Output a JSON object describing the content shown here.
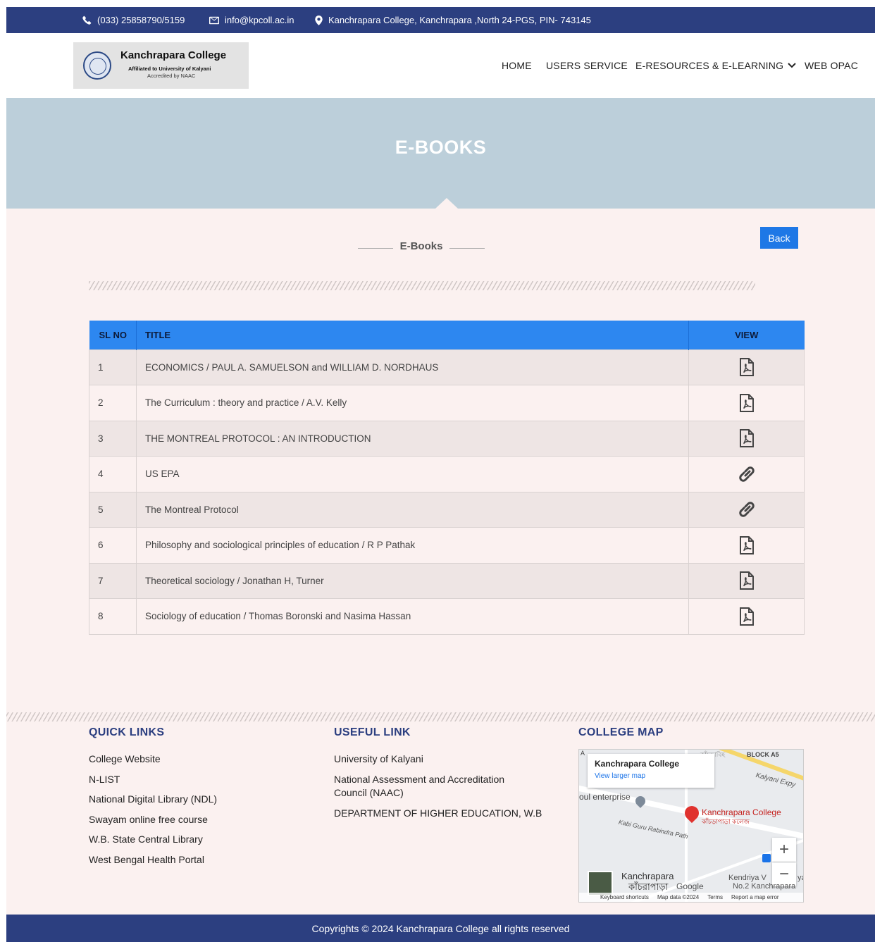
{
  "topbar": {
    "phone": "(033) 25858790/5159",
    "email": "info@kpcoll.ac.in",
    "address": "Kanchrapara College, Kanchrapara ,North 24-PGS, PIN- 743145"
  },
  "logo": {
    "title": "Kanchrapara College",
    "line1": "Affiliated to University of Kalyani",
    "line2": "Accredited by NAAC"
  },
  "nav": {
    "home": "HOME",
    "users_service": "USERS SERVICE",
    "eresources": "E-RESOURCES & E-LEARNING",
    "web_opac": "WEB OPAC"
  },
  "banner": {
    "title": "E-BOOKS"
  },
  "section": {
    "title": "E-Books",
    "back": "Back"
  },
  "table": {
    "headers": {
      "sl": "SL NO",
      "title": "TITLE",
      "view": "VIEW"
    },
    "rows": [
      {
        "sl": "1",
        "title": "ECONOMICS / PAUL A. SAMUELSON and WILLIAM D. NORDHAUS",
        "view_icon": "pdf-icon"
      },
      {
        "sl": "2",
        "title": "The Curriculum : theory and practice / A.V. Kelly",
        "view_icon": "pdf-icon"
      },
      {
        "sl": "3",
        "title": "THE MONTREAL PROTOCOL : AN INTRODUCTION",
        "view_icon": "pdf-icon"
      },
      {
        "sl": "4",
        "title": "US EPA",
        "view_icon": "link-icon"
      },
      {
        "sl": "5",
        "title": "The Montreal Protocol",
        "view_icon": "link-icon"
      },
      {
        "sl": "6",
        "title": "Philosophy and sociological principles of education / R P Pathak",
        "view_icon": "pdf-icon"
      },
      {
        "sl": "7",
        "title": "Theoretical sociology / Jonathan H, Turner",
        "view_icon": "pdf-icon"
      },
      {
        "sl": "8",
        "title": "Sociology of education / Thomas Boronski and Nasima Hassan",
        "view_icon": "pdf-icon"
      }
    ]
  },
  "footer": {
    "quick_links": {
      "title": "QUICK LINKS",
      "items": [
        "College Website",
        "N-LIST",
        "National Digital Library (NDL)",
        "Swayam online free course",
        "W.B. State Central Library",
        "West Bengal Health Portal"
      ]
    },
    "useful_link": {
      "title": "USEFUL LINK",
      "item0": "University of Kalyani",
      "item1a": "National Assessment and Accreditation",
      "item1b": "Council (NAAC)",
      "item2": "DEPARTMENT OF HIGHER EDUCATION, W.B"
    },
    "college_map": {
      "title": "COLLEGE MAP",
      "place_name": "Kanchrapara College",
      "view_larger": "View larger map",
      "pin_label": "Kanchrapara College",
      "pin_label_bn": "কাঁচড়াপাড়া কলেজ",
      "label_block": "BLOCK A5",
      "label_expy": "Kalyani Expy",
      "label_enterprise": "oul enterprise",
      "label_road": "Kabi Guru Rabindra Path",
      "label_town": "Kanchrapara",
      "label_town_bn": "কাঁচরাপাড়া",
      "label_kv1": "Kendriya V",
      "label_kv1b": "ya",
      "label_kv2": "No.2 Kanchrapara",
      "label_partial": "A",
      "label_bn_top": "কাঁচড়াবিহ",
      "zoom_in": "+",
      "zoom_out": "−",
      "google": "Google",
      "keyboard": "Keyboard shortcuts",
      "map_data": "Map data ©2024",
      "terms": "Terms",
      "report": "Report a map error"
    },
    "copyright": "Copyrights © 2024 Kanchrapara College all rights reserved"
  },
  "colors": {
    "topbar": "#2c3f80",
    "banner": "#bccfda",
    "table_header": "#2d87f0",
    "button": "#1e78e6",
    "background": "#fbf1f0"
  }
}
